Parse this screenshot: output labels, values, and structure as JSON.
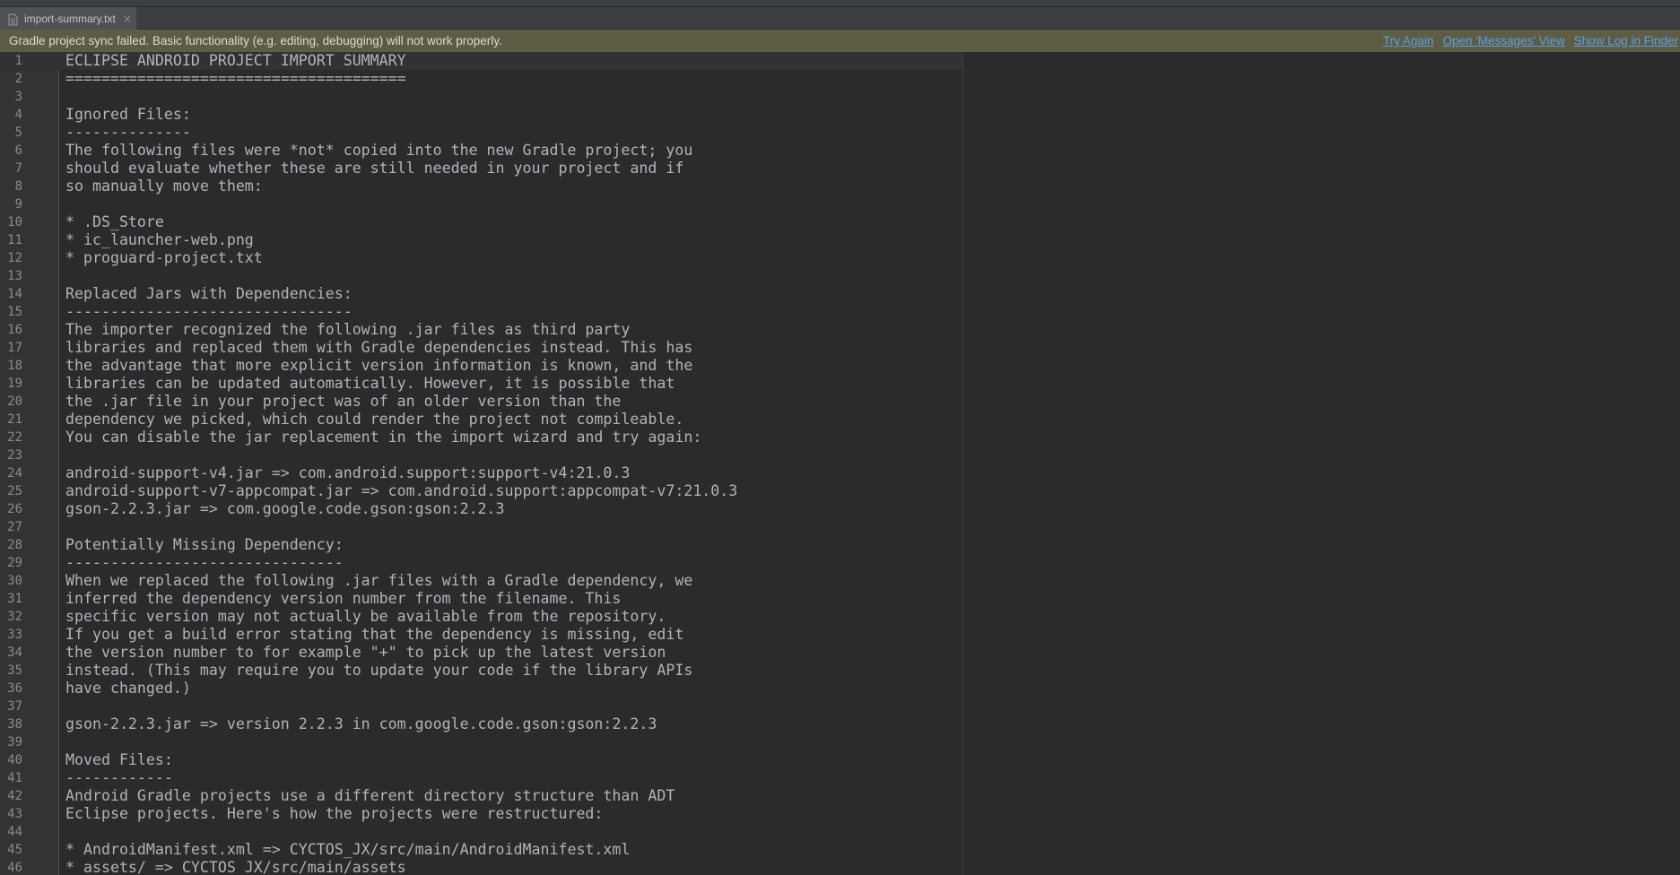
{
  "tab": {
    "label": "import-summary.txt",
    "icon": "text-file-icon",
    "close_glyph": "×"
  },
  "notification": {
    "message": "Gradle project sync failed. Basic functionality (e.g. editing, debugging) will not work properly.",
    "links": [
      "Try Again",
      "Open 'Messages' View",
      "Show Log in Finder"
    ]
  },
  "editor": {
    "current_line": 1,
    "lines": [
      "ECLIPSE ANDROID PROJECT IMPORT SUMMARY",
      "======================================",
      "",
      "Ignored Files:",
      "--------------",
      "The following files were *not* copied into the new Gradle project; you",
      "should evaluate whether these are still needed in your project and if",
      "so manually move them:",
      "",
      "* .DS_Store",
      "* ic_launcher-web.png",
      "* proguard-project.txt",
      "",
      "Replaced Jars with Dependencies:",
      "--------------------------------",
      "The importer recognized the following .jar files as third party",
      "libraries and replaced them with Gradle dependencies instead. This has",
      "the advantage that more explicit version information is known, and the",
      "libraries can be updated automatically. However, it is possible that",
      "the .jar file in your project was of an older version than the",
      "dependency we picked, which could render the project not compileable.",
      "You can disable the jar replacement in the import wizard and try again:",
      "",
      "android-support-v4.jar => com.android.support:support-v4:21.0.3",
      "android-support-v7-appcompat.jar => com.android.support:appcompat-v7:21.0.3",
      "gson-2.2.3.jar => com.google.code.gson:gson:2.2.3",
      "",
      "Potentially Missing Dependency:",
      "-------------------------------",
      "When we replaced the following .jar files with a Gradle dependency, we",
      "inferred the dependency version number from the filename. This",
      "specific version may not actually be available from the repository.",
      "If you get a build error stating that the dependency is missing, edit",
      "the version number to for example \"+\" to pick up the latest version",
      "instead. (This may require you to update your code if the library APIs",
      "have changed.)",
      "",
      "gson-2.2.3.jar => version 2.2.3 in com.google.code.gson:gson:2.2.3",
      "",
      "Moved Files:",
      "------------",
      "Android Gradle projects use a different directory structure than ADT",
      "Eclipse projects. Here's how the projects were restructured:",
      "",
      "* AndroidManifest.xml => CYCTOS_JX/src/main/AndroidManifest.xml",
      "* assets/ => CYCTOS_JX/src/main/assets"
    ]
  }
}
